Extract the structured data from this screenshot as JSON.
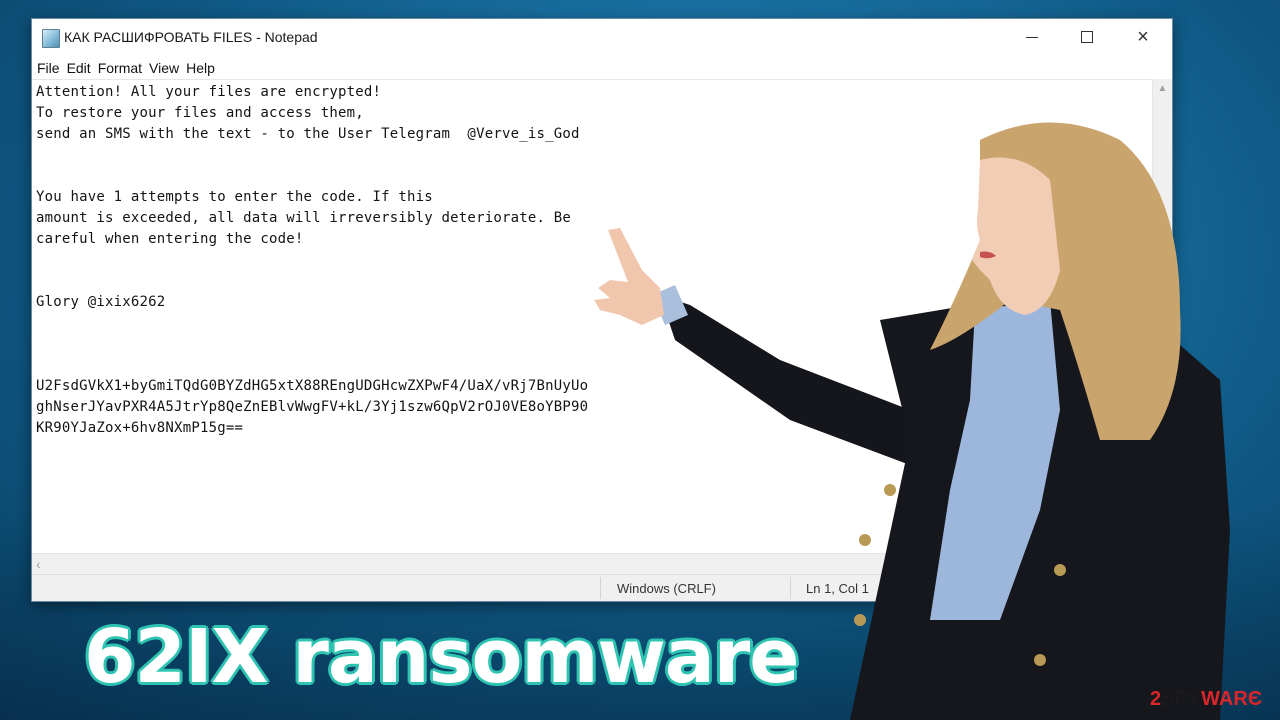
{
  "window": {
    "title": "КАК РАСШИФРОВАТЬ FILES - Notepad",
    "controls": {
      "minimize": "minimize",
      "maximize": "maximize",
      "close": "×"
    }
  },
  "menu": {
    "items": [
      "File",
      "Edit",
      "Format",
      "View",
      "Help"
    ]
  },
  "editor": {
    "content": "Attention! All your files are encrypted!\nTo restore your files and access them,\nsend an SMS with the text - to the User Telegram  @Verve_is_God\n\n\nYou have 1 attempts to enter the code. If this\namount is exceeded, all data will irreversibly deteriorate. Be\ncareful when entering the code!\n\n\nGlory @ixix6262\n\n\n\nU2FsdGVkX1+byGmiTQdG0BYZdHG5xtX88REngUDGHcwZXPwF4/UaX/vRj7BnUyUo\nghNserJYavPXR4A5JtrYp8QeZnEBlvWwgFV+kL/3Yj1szw6QpV2rOJ0VE8oYBP90\nKR90YJaZox+6hv8NXmP15g=="
  },
  "scrollbars": {
    "up_arrow": "▲",
    "left_arrow": "‹"
  },
  "status": {
    "line_ending": "Windows (CRLF)",
    "position": "Ln 1, Col 1"
  },
  "caption": "62IX ransomware",
  "watermark": {
    "num": "2",
    "spy": "SPY",
    "ware": "WARЄ"
  },
  "colors": {
    "background": "#1b74a6",
    "caption_outline": "#2fc4b2",
    "logo_red": "#d9262b"
  }
}
